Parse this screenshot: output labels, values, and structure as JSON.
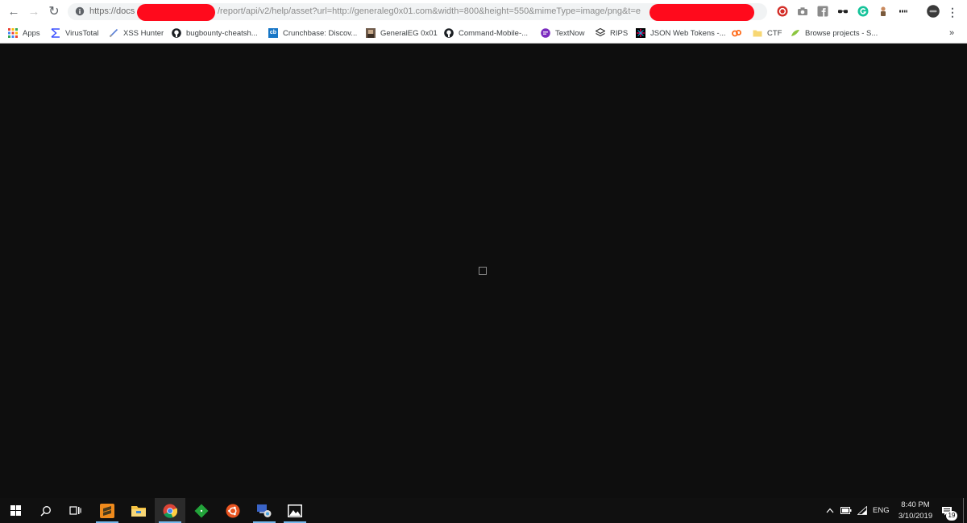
{
  "browser": {
    "url_prefix": "https://docs",
    "url_path": "/report/api/v2/help/asset?url=http://generaleg0x01.com&width=800&height=550&mimeType=image/png&t=e",
    "menu_glyph": "⋮",
    "nav": {
      "back": "←",
      "forward": "→",
      "reload": "↻"
    },
    "redaction_color": "#ff0a1c"
  },
  "bookmarks": {
    "apps_label": "Apps",
    "items": [
      {
        "label": "VirusTotal",
        "icon": "virustotal-icon"
      },
      {
        "label": "XSS Hunter",
        "icon": "xss-hunter-icon"
      },
      {
        "label": "bugbounty-cheatsh...",
        "icon": "github-icon"
      },
      {
        "label": "Crunchbase: Discov...",
        "icon": "crunchbase-icon",
        "badge": "cb"
      },
      {
        "label": "GeneralEG 0x01",
        "icon": "generaleg-icon"
      },
      {
        "label": "Command-Mobile-...",
        "icon": "github-icon"
      },
      {
        "label": "TextNow",
        "icon": "textnow-icon"
      },
      {
        "label": "RIPS",
        "icon": "rips-icon"
      },
      {
        "label": "JSON Web Tokens -...",
        "icon": "jwt-icon"
      },
      {
        "label": "",
        "icon": "cp-icon"
      },
      {
        "label": "CTF",
        "icon": "folder-icon"
      },
      {
        "label": "Browse projects - S...",
        "icon": "browse-projects-icon"
      }
    ],
    "overflow": "»"
  },
  "taskbar": {
    "clock_time": "8:40 PM",
    "clock_date": "3/10/2019",
    "language": "ENG",
    "notification_count": "19"
  }
}
